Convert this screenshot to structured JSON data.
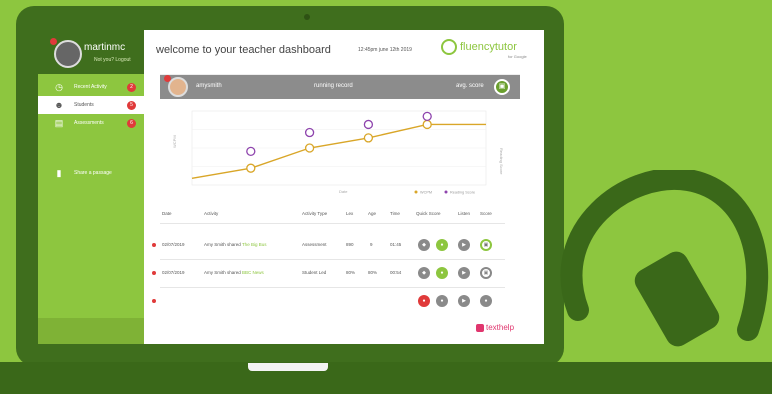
{
  "sidebar": {
    "user_name": "martinmc",
    "user_links": "Not you? Logout",
    "items": [
      {
        "label": "Recent Activity",
        "badge": "2",
        "icon": "clock-icon"
      },
      {
        "label": "Students",
        "badge": "5",
        "icon": "users-icon"
      },
      {
        "label": "Assessments",
        "badge": "6",
        "icon": "document-icon"
      },
      {
        "label": "Share a passage",
        "badge": "",
        "icon": "share-icon"
      }
    ]
  },
  "header": {
    "title": "welcome to your teacher dashboard",
    "time": "12:45pm  june 12th 2019",
    "brand": "fluencytutor",
    "brand_sub": "for Google"
  },
  "panel": {
    "student_name": "amysmith",
    "record_label": "running record",
    "score_label": "avg. score"
  },
  "chart_data": {
    "type": "line",
    "x": [
      1,
      2,
      3,
      4,
      5,
      6
    ],
    "series": [
      {
        "name": "WCPM",
        "values": [
          10,
          25,
          55,
          70,
          90,
          90
        ],
        "color": "#d9a628"
      },
      {
        "name": "Reading Score",
        "values": [
          null,
          50,
          78,
          90,
          102,
          null
        ],
        "color": "#8e44ad"
      }
    ],
    "xlabel": "Date",
    "ylabel": "WCPM",
    "y2label": "Reading Score",
    "legend": [
      "WCPM",
      "Reading Score"
    ]
  },
  "table": {
    "headers": [
      "Date",
      "Activity",
      "Activity Type",
      "Lex",
      "Age",
      "Time",
      "Quick Score",
      "Listen",
      "Score"
    ],
    "rows": [
      {
        "date": "02/07/2019",
        "activity_prefix": "Amy Smith shared ",
        "activity_link": "The Big Bus",
        "type": "Assessment",
        "lex": "890",
        "age": "9",
        "time": "01:45"
      },
      {
        "date": "02/07/2019",
        "activity_prefix": "Amy Smith shared ",
        "activity_link": "BBC News",
        "type": "Student Led",
        "lex": "80%",
        "age": "80%",
        "time": "00:54"
      }
    ]
  },
  "footer": {
    "brand": "texthelp"
  }
}
